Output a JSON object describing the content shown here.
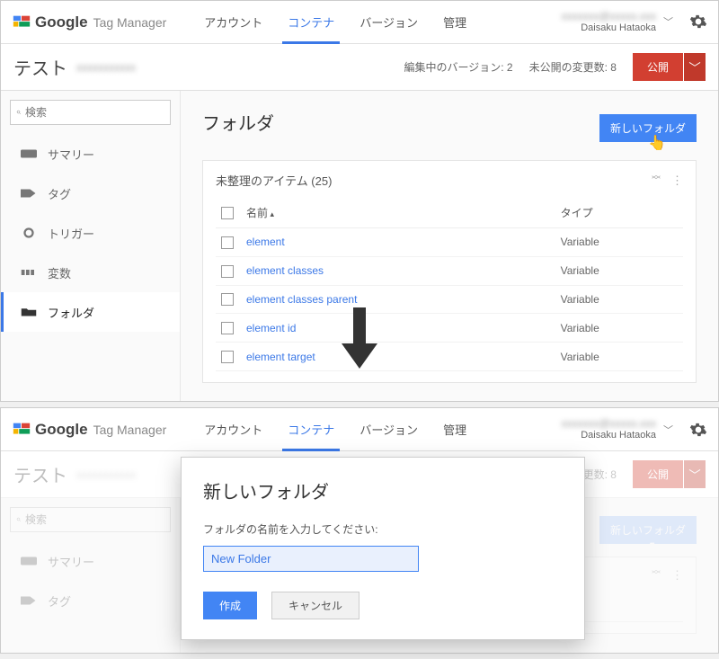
{
  "brand": {
    "google": "Google",
    "product": "Tag Manager"
  },
  "header": {
    "tabs": [
      "アカウント",
      "コンテナ",
      "バージョン",
      "管理"
    ],
    "active_tab_index": 1,
    "user_name": "Daisaku Hataoka"
  },
  "subbar": {
    "container_name": "テスト",
    "editing_version_label": "編集中のバージョン:",
    "editing_version_value": "2",
    "unpublished_label": "未公開の変更数:",
    "unpublished_value": "8",
    "publish_btn": "公開"
  },
  "sidebar": {
    "search_placeholder": "検索",
    "items": [
      {
        "label": "サマリー",
        "icon": "summary"
      },
      {
        "label": "タグ",
        "icon": "tag"
      },
      {
        "label": "トリガー",
        "icon": "trigger"
      },
      {
        "label": "変数",
        "icon": "variable"
      },
      {
        "label": "フォルダ",
        "icon": "folder"
      }
    ],
    "active_index": 4
  },
  "main": {
    "title": "フォルダ",
    "new_folder_btn": "新しいフォルダ",
    "unsorted_title": "未整理のアイテム (25)",
    "columns": {
      "name": "名前",
      "type": "タイプ"
    },
    "rows": [
      {
        "name": "element",
        "type": "Variable"
      },
      {
        "name": "element classes",
        "type": "Variable"
      },
      {
        "name": "element classes parent",
        "type": "Variable"
      },
      {
        "name": "element id",
        "type": "Variable"
      },
      {
        "name": "element target",
        "type": "Variable"
      }
    ]
  },
  "dialog": {
    "title": "新しいフォルダ",
    "label": "フォルダの名前を入力してください:",
    "input_value": "New Folder",
    "create": "作成",
    "cancel": "キャンセル"
  }
}
